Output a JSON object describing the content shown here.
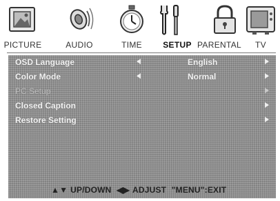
{
  "tabs": [
    {
      "id": "picture",
      "label": "PICTURE",
      "icon": "picture-frame-icon",
      "active": false
    },
    {
      "id": "audio",
      "label": "AUDIO",
      "icon": "speaker-icon",
      "active": false
    },
    {
      "id": "time",
      "label": "TIME",
      "icon": "stopwatch-icon",
      "active": false
    },
    {
      "id": "setup",
      "label": "SETUP",
      "icon": "wrench-screwdriver-icon",
      "active": true
    },
    {
      "id": "parental",
      "label": "PARENTAL",
      "icon": "padlock-icon",
      "active": false
    },
    {
      "id": "tv",
      "label": "TV",
      "icon": "tv-set-icon",
      "active": false
    }
  ],
  "menu": {
    "items": [
      {
        "label": "OSD Language",
        "value": "English",
        "enabled": true,
        "has_left_arrow": true
      },
      {
        "label": "Color Mode",
        "value": "Normal",
        "enabled": true,
        "has_left_arrow": true
      },
      {
        "label": "PC Setup",
        "value": "",
        "enabled": false,
        "has_left_arrow": false
      },
      {
        "label": "Closed Caption",
        "value": "",
        "enabled": true,
        "has_left_arrow": false
      },
      {
        "label": "Restore Setting",
        "value": "",
        "enabled": true,
        "has_left_arrow": false
      }
    ]
  },
  "footer": {
    "updown_symbol": "▲▼",
    "updown_text": "UP/DOWN",
    "adjust_symbol": "◀▶",
    "adjust_text": "ADJUST",
    "exit_text": "\"MENU\":EXIT"
  },
  "colors": {
    "panel": "#8c8c8c",
    "active_label": "#111111"
  }
}
